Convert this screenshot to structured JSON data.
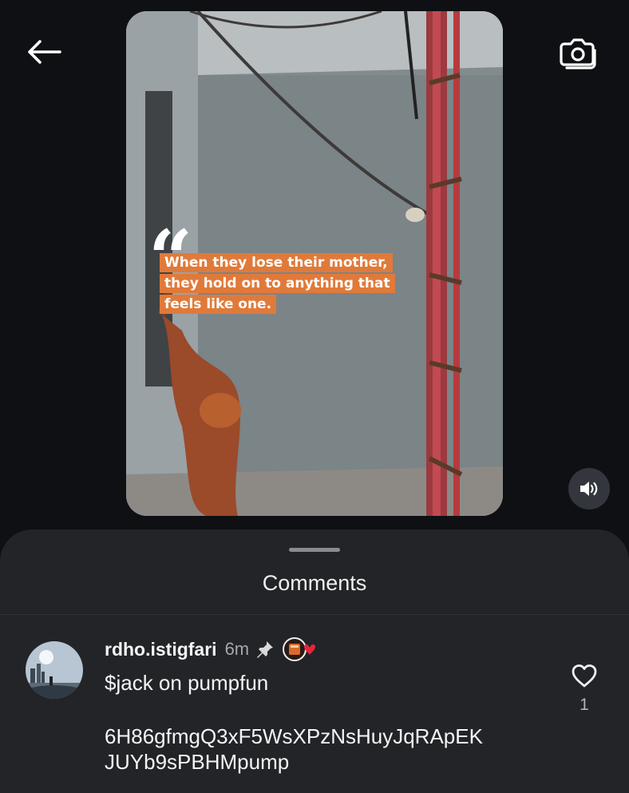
{
  "header": {
    "back_icon": "arrow-left-icon",
    "camera_icon": "camera-flip-icon"
  },
  "video": {
    "caption_lines": [
      "When they lose their mother,",
      "they hold on to anything that",
      "feels like one."
    ],
    "quote_mark": "“",
    "caption_color": "#e07a3a",
    "sound_icon": "speaker-icon"
  },
  "comments": {
    "title": "Comments",
    "items": [
      {
        "username": "rdho.istigfari",
        "time": "6m",
        "pinned_icon": "pin-icon",
        "badge_icon": "creator-heart-badge-icon",
        "text": "$jack on pumpfun",
        "code_lines": [
          "6H86gfmgQ3xF5WsXPzNsHuyJqRApEK",
          "JUYb9sPBHMpump"
        ],
        "like_icon": "heart-outline-icon",
        "likes": "1"
      }
    ]
  },
  "colors": {
    "background": "#0e1014",
    "sheet": "#222428",
    "accent_heart": "#e8243c"
  }
}
